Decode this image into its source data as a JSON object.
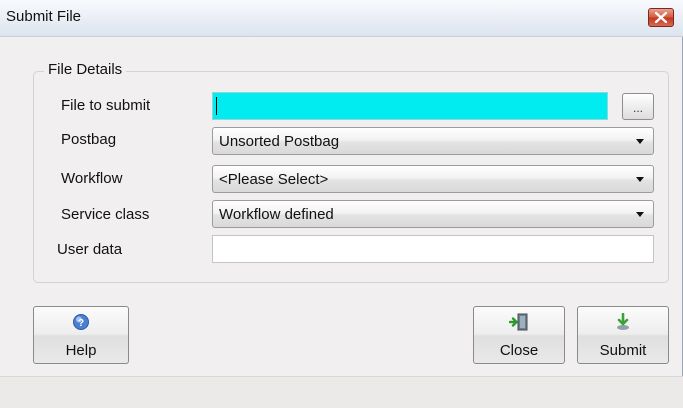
{
  "window": {
    "title": "Submit File"
  },
  "group": {
    "title": "File Details"
  },
  "fields": {
    "file_label": "File to submit",
    "file_value": "",
    "browse_label": "...",
    "postbag_label": "Postbag",
    "postbag_value": "Unsorted Postbag",
    "workflow_label": "Workflow",
    "workflow_value": "<Please Select>",
    "service_label": "Service class",
    "service_value": "Workflow defined",
    "userdata_label": "User data",
    "userdata_value": ""
  },
  "buttons": {
    "help": "Help",
    "close": "Close",
    "submit": "Submit"
  },
  "icons": {
    "window_close": "close-x-icon",
    "help": "help-icon",
    "close": "exit-door-icon",
    "submit": "submit-arrow-icon"
  },
  "colors": {
    "file_field_bg": "#00ecf0",
    "close_button": "#d65a40"
  }
}
